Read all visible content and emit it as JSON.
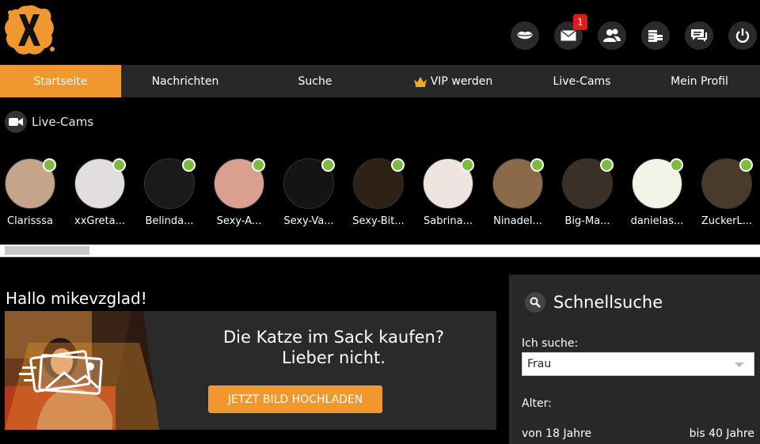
{
  "header": {
    "logo_icon": "x-splat-logo",
    "message_badge": "1",
    "icons": [
      "lips-icon",
      "mail-icon",
      "users-icon",
      "coins-icon",
      "chat-icon",
      "power-icon"
    ]
  },
  "nav": {
    "items": [
      {
        "label": "Startseite",
        "active": true
      },
      {
        "label": "Nachrichten",
        "active": false
      },
      {
        "label": "Suche",
        "active": false
      },
      {
        "label": "VIP werden",
        "active": false,
        "icon": "crown-icon"
      },
      {
        "label": "Live-Cams",
        "active": false
      },
      {
        "label": "Mein Profil",
        "active": false
      }
    ]
  },
  "live_cams": {
    "title": "Live-Cams",
    "users": [
      {
        "name": "Clarisssa",
        "color": "#c4a58c"
      },
      {
        "name": "xxGreta...",
        "color": "#e2dedd"
      },
      {
        "name": "Belinda...",
        "color": "#1a1a1a"
      },
      {
        "name": "Sexy-A...",
        "color": "#d9a090"
      },
      {
        "name": "Sexy-Va...",
        "color": "#141414"
      },
      {
        "name": "Sexy-Bit...",
        "color": "#2e2118"
      },
      {
        "name": "Sabrina...",
        "color": "#efe5de"
      },
      {
        "name": "Ninadel...",
        "color": "#8a6a48"
      },
      {
        "name": "Big-Ma...",
        "color": "#3a3028"
      },
      {
        "name": "danielas...",
        "color": "#f2f4e8"
      },
      {
        "name": "ZuckerL...",
        "color": "#4a3a2a"
      }
    ]
  },
  "greeting": "Hallo mikevzglad!",
  "banner": {
    "line1": "Die Katze im Sack kaufen?",
    "line2": "Lieber nicht.",
    "button": "JETZT BILD HOCHLADEN"
  },
  "quick_search": {
    "title": "Schnellsuche",
    "seek_label": "Ich suche:",
    "seek_value": "Frau",
    "age_label": "Alter:",
    "age_from": "von 18 Jahre",
    "age_to": "bis 40 Jahre"
  },
  "colors": {
    "accent": "#f0972d",
    "online": "#7dbb42",
    "nav_bg": "#282828"
  }
}
